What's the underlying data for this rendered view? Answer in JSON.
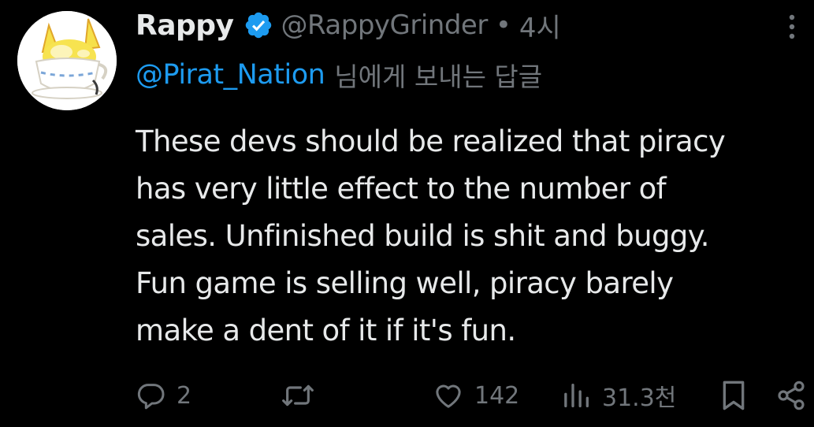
{
  "author": {
    "display_name": "Rappy",
    "handle": "@RappyGrinder",
    "separator": "•",
    "time": "4시",
    "avatar_icon": "rappy-teacup-avatar",
    "verified_icon": "verified-badge-icon"
  },
  "reply_context": {
    "mention": "@Pirat_Nation",
    "suffix": "님에게 보내는 답글"
  },
  "tweet": {
    "lines": [
      "These devs should be realized that piracy",
      "has very little effect to the number of",
      "sales. Unfinished build is shit and buggy.",
      "Fun game is selling well, piracy barely",
      "make a dent of it if it's fun."
    ]
  },
  "actions": {
    "reply_count": "2",
    "retweet_count": "",
    "like_count": "142",
    "views_count": "31.3천"
  },
  "colors": {
    "background": "#000000",
    "text": "#e7e9ea",
    "muted": "#71767b",
    "accent": "#1d9bf0"
  }
}
